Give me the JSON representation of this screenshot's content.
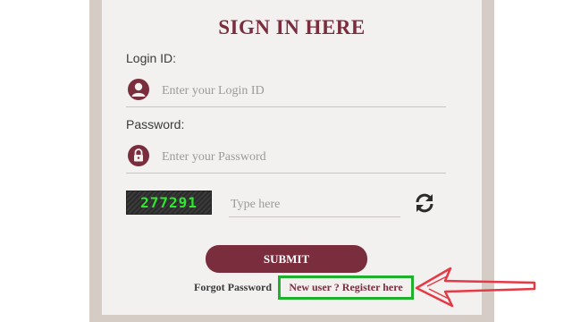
{
  "form": {
    "title": "SIGN IN HERE",
    "login_label": "Login ID:",
    "login_placeholder": "Enter your Login ID",
    "password_label": "Password:",
    "password_placeholder": "Enter your Password",
    "captcha_code": "277291",
    "captcha_placeholder": "Type here",
    "submit_label": "SUBMIT",
    "forgot_label": "Forgot Password",
    "register_label": "New user ? Register here"
  },
  "icons": {
    "login": "user-icon",
    "password": "lock-icon",
    "refresh": "refresh-icon",
    "arrow": "arrow-annotation"
  },
  "colors": {
    "accent": "#7a2d3c",
    "highlight_box": "#1fb02e",
    "annotation_arrow": "#e63946",
    "captcha_text": "#2ee82e"
  }
}
